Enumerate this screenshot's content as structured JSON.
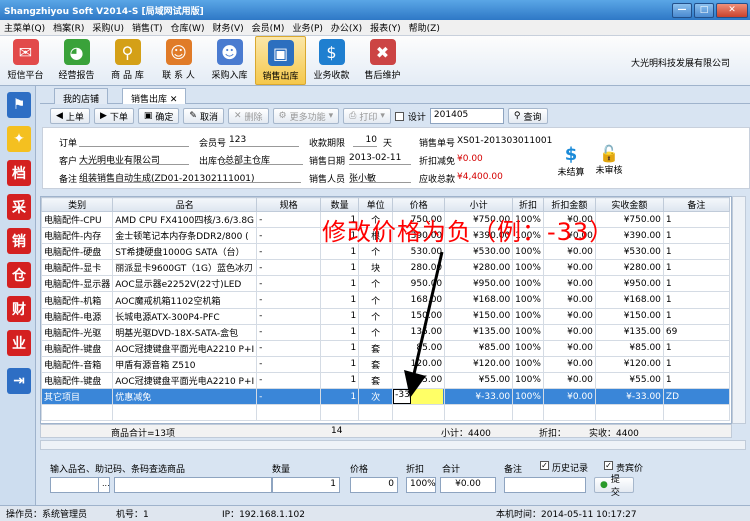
{
  "window": {
    "title": "Shangzhiyou Soft V2014-S [局域网试用版]",
    "min": "—",
    "max": "□",
    "close": "✕"
  },
  "menu": [
    "主菜单(Q)",
    "档案(R)",
    "采购(U)",
    "销售(T)",
    "仓库(W)",
    "财务(V)",
    "会员(M)",
    "业务(P)",
    "办公(X)",
    "报表(Y)",
    "帮助(Z)"
  ],
  "ribbon": [
    {
      "label": "短信平台",
      "icon": "envelope-icon",
      "color": "#e24a4a",
      "glyph": "✉"
    },
    {
      "label": "经营报告",
      "icon": "pie-chart-icon",
      "color": "#3aa23a",
      "glyph": "◕"
    },
    {
      "label": "商 品 库",
      "icon": "magnifier-icon",
      "color": "#d4a017",
      "glyph": "⚲"
    },
    {
      "label": "联 系 人",
      "icon": "person-icon",
      "color": "#e07b28",
      "glyph": "☺"
    },
    {
      "label": "采购入库",
      "icon": "people-icon",
      "color": "#4a7bd0",
      "glyph": "☻"
    },
    {
      "label": "销售出库",
      "icon": "monitor-icon",
      "color": "#2c6fbf",
      "glyph": "▣"
    },
    {
      "label": "业务收款",
      "icon": "dollar-icon",
      "color": "#1f7fd0",
      "glyph": "$"
    },
    {
      "label": "售后维护",
      "icon": "tools-icon",
      "color": "#c44",
      "glyph": "✖"
    }
  ],
  "company": "大光明科技发展有限公司",
  "tabs": [
    "我的店铺",
    "销售出库"
  ],
  "tab_close": "✕",
  "toolbar": {
    "up": "上单",
    "down": "下单",
    "confirm": "确定",
    "cancel": "取消",
    "delete": "删除",
    "more": "更多功能",
    "print": "打印",
    "design": "设计",
    "period": "201405",
    "query": "查询"
  },
  "form": {
    "order_label": "订单",
    "member_label": "会员号",
    "member": "123",
    "term_label": "收款期限",
    "term": "10",
    "term_unit": "天",
    "sale_no_label": "销售单号",
    "sale_no": "XS01-201303011001",
    "customer_label": "客户",
    "customer": "大光明电业有限公司",
    "warehouse_label": "出库仓",
    "warehouse": "总部主仓库",
    "date_label": "销售日期",
    "date": "2013-02-11",
    "discount_label": "折扣减免",
    "discount": "¥0.00",
    "note_label": "备注",
    "note": "组装销售自动生成(ZD01-201302111001)",
    "seller_label": "销售人员",
    "seller": "张小敏",
    "total_label": "应收总款",
    "total": "¥4,400.00",
    "unsettle": "未结算",
    "unaudit": "未审核"
  },
  "table": {
    "headers": [
      "类别",
      "品名",
      "规格",
      "数量",
      "单位",
      "价格",
      "小计",
      "折扣",
      "折扣金额",
      "实收金额",
      "备注"
    ],
    "rows": [
      [
        "电脑配件-CPU",
        "AMD CPU FX4100四核/3.6/3.8G",
        "-",
        "1",
        "个",
        "750.00",
        "¥750.00",
        "100%",
        "¥0.00",
        "¥750.00",
        "1"
      ],
      [
        "电脑配件-内存",
        "金士顿笔记本内存条DDR2/800 (",
        "-",
        "1",
        "根",
        "390.00",
        "¥390.00",
        "100%",
        "¥0.00",
        "¥390.00",
        "1"
      ],
      [
        "电脑配件-硬盘",
        "ST希捷硬盘1000G SATA（台）",
        "-",
        "1",
        "个",
        "530.00",
        "¥530.00",
        "100%",
        "¥0.00",
        "¥530.00",
        "1"
      ],
      [
        "电脑配件-显卡",
        "丽派显卡9600GT（1G）蓝色冰刃",
        "-",
        "1",
        "块",
        "280.00",
        "¥280.00",
        "100%",
        "¥0.00",
        "¥280.00",
        "1"
      ],
      [
        "电脑配件-显示器",
        "AOC显示器e2252V(22寸)LED",
        "-",
        "1",
        "个",
        "950.00",
        "¥950.00",
        "100%",
        "¥0.00",
        "¥950.00",
        "1"
      ],
      [
        "电脑配件-机箱",
        "AOC魔戒机箱1102空机箱",
        "-",
        "1",
        "个",
        "168.00",
        "¥168.00",
        "100%",
        "¥0.00",
        "¥168.00",
        "1"
      ],
      [
        "电脑配件-电源",
        "长城电源ATX-300P4-PFC",
        "-",
        "1",
        "个",
        "150.00",
        "¥150.00",
        "100%",
        "¥0.00",
        "¥150.00",
        "1"
      ],
      [
        "电脑配件-光驱",
        "明基光驱DVD-18X-SATA-盒包",
        "-",
        "1",
        "个",
        "135.00",
        "¥135.00",
        "100%",
        "¥0.00",
        "¥135.00",
        "69"
      ],
      [
        "电脑配件-键盘",
        "AOC冠捷键盘平面光电A2210 P+I",
        "-",
        "1",
        "套",
        "85.00",
        "¥85.00",
        "100%",
        "¥0.00",
        "¥85.00",
        "1"
      ],
      [
        "电脑配件-音箱",
        "甲盾有源音箱 Z510",
        "-",
        "1",
        "套",
        "120.00",
        "¥120.00",
        "100%",
        "¥0.00",
        "¥120.00",
        "1"
      ],
      [
        "电脑配件-键盘",
        "AOC冠捷键盘平面光电A2210 P+I",
        "-",
        "1",
        "套",
        "55.00",
        "¥55.00",
        "100%",
        "¥0.00",
        "¥55.00",
        "1"
      ]
    ],
    "selected_row": [
      "其它项目",
      "优惠减免",
      "-",
      "1",
      "次",
      "-33",
      "",
      "¥-33.00",
      "100%",
      "¥0.00",
      "¥-33.00",
      "ZD"
    ]
  },
  "summary": {
    "count": "商品合计=13项",
    "qty": "14",
    "subtotal": "小计：4400",
    "discount": "折扣：",
    "received": "实收：4400"
  },
  "entry": {
    "search_label": "输入品名、助记码、条码查选商品",
    "qty_label": "数量",
    "qty": "1",
    "price_label": "价格",
    "price": "0",
    "disc_label": "折扣",
    "disc": "100%",
    "sum_label": "合计",
    "sum": "¥0.00",
    "note_label": "备注",
    "history": "历史记录",
    "vip": "贵宾价",
    "submit": "提交",
    "more": "..."
  },
  "status": {
    "operator": "操作员：系统管理员",
    "machine": "机号：1",
    "ip": "IP：192.168.1.102",
    "time": "本机时间：2014-05-11 10:17:27"
  },
  "overlay": "修改价格为负（例：-33）",
  "leftbar": [
    "flag",
    "bulb",
    "档",
    "采",
    "销",
    "仓",
    "财",
    "业",
    "exit"
  ]
}
